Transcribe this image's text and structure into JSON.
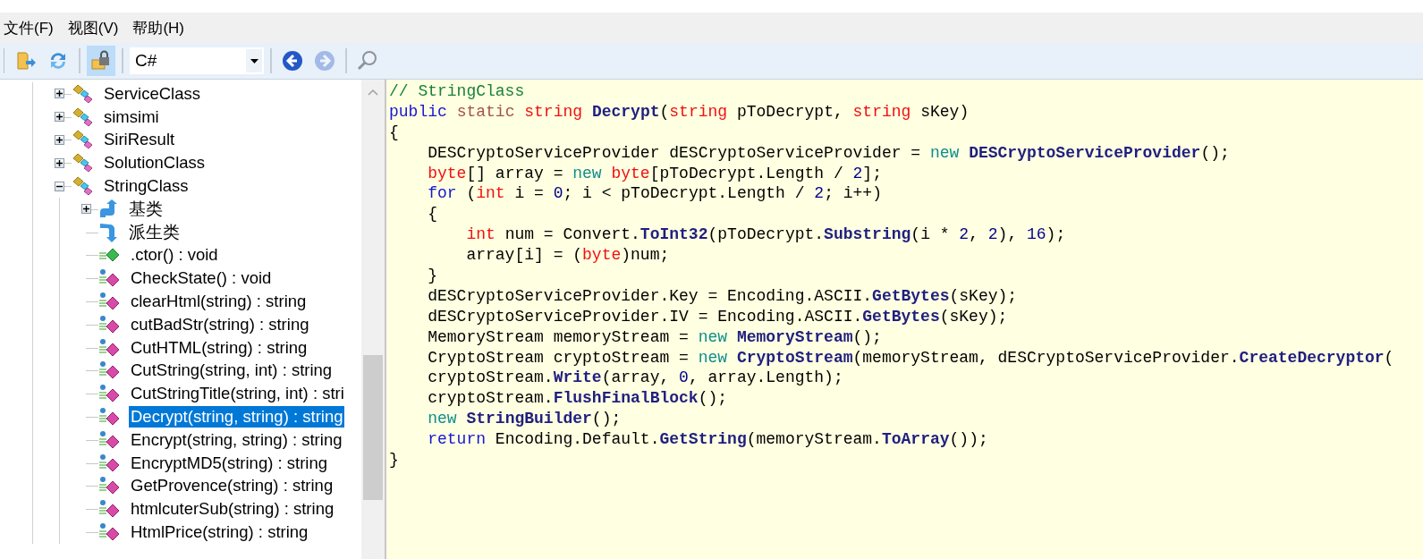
{
  "menu": [
    {
      "label": "文件(F)"
    },
    {
      "label": "视图(V)"
    },
    {
      "label": "帮助(H)"
    }
  ],
  "toolbar": {
    "file_tools": [
      {
        "kind": "open",
        "pressed": false,
        "disabled": false
      },
      {
        "kind": "refresh",
        "pressed": false,
        "disabled": false
      }
    ],
    "view_tools": [
      {
        "kind": "lock",
        "pressed": true,
        "disabled": false
      }
    ],
    "language": "C#",
    "nav_tools": [
      {
        "kind": "back",
        "pressed": false,
        "disabled": false
      },
      {
        "kind": "forward",
        "pressed": false,
        "disabled": true
      }
    ],
    "search_tools": [
      {
        "kind": "search",
        "pressed": false,
        "disabled": false
      }
    ]
  },
  "tree": {
    "items": [
      {
        "kind": "class",
        "label": "ServiceClass",
        "expanded": false,
        "selected": false
      },
      {
        "kind": "class",
        "label": "simsimi",
        "expanded": false,
        "selected": false
      },
      {
        "kind": "class",
        "label": "SiriResult",
        "expanded": false,
        "selected": false
      },
      {
        "kind": "class",
        "label": "SolutionClass",
        "expanded": false,
        "selected": false
      },
      {
        "kind": "class",
        "label": "StringClass",
        "expanded": true,
        "selected": false,
        "children": [
          {
            "kind": "base_types",
            "label": "基类",
            "expanded": false,
            "selected": false
          },
          {
            "kind": "derived_types",
            "label": "派生类",
            "selected": false
          },
          {
            "kind": "constructor",
            "label": ".ctor() : void",
            "selected": false
          },
          {
            "kind": "method",
            "label": "CheckState() : void",
            "selected": false
          },
          {
            "kind": "method",
            "label": "clearHtml(string) : string",
            "selected": false
          },
          {
            "kind": "method",
            "label": "cutBadStr(string) : string",
            "selected": false
          },
          {
            "kind": "method",
            "label": "CutHTML(string) : string",
            "selected": false
          },
          {
            "kind": "method",
            "label": "CutString(string, int) : string",
            "selected": false
          },
          {
            "kind": "method",
            "label": "CutStringTitle(string, int) : stri",
            "selected": false
          },
          {
            "kind": "method",
            "label": "Decrypt(string, string) : string",
            "selected": true
          },
          {
            "kind": "method",
            "label": "Encrypt(string, string) : string",
            "selected": false
          },
          {
            "kind": "method",
            "label": "EncryptMD5(string) : string",
            "selected": false
          },
          {
            "kind": "method",
            "label": "GetProvence(string) : string",
            "selected": false
          },
          {
            "kind": "method",
            "label": "htmlcuterSub(string) : string",
            "selected": false
          },
          {
            "kind": "method",
            "label": "HtmlPrice(string) : string",
            "selected": false
          }
        ]
      }
    ]
  },
  "code": {
    "lines": [
      {
        "tokens": [
          {
            "kind": "comment",
            "text": "// StringClass"
          }
        ]
      },
      {
        "tokens": [
          {
            "kind": "keyword",
            "text": "public "
          },
          {
            "kind": "modifier",
            "text": "static "
          },
          {
            "kind": "type",
            "text": "string "
          },
          {
            "kind": "member",
            "text": "Decrypt"
          },
          {
            "kind": "plain",
            "text": "("
          },
          {
            "kind": "type",
            "text": "string"
          },
          {
            "kind": "plain",
            "text": " pToDecrypt, "
          },
          {
            "kind": "type",
            "text": "string"
          },
          {
            "kind": "plain",
            "text": " sKey)"
          }
        ]
      },
      {
        "tokens": [
          {
            "kind": "plain",
            "text": "{"
          }
        ]
      },
      {
        "tokens": [
          {
            "kind": "plain",
            "text": "    DESCryptoServiceProvider dESCryptoServiceProvider = "
          },
          {
            "kind": "new",
            "text": "new "
          },
          {
            "kind": "member",
            "text": "DESCryptoServiceProvider"
          },
          {
            "kind": "plain",
            "text": "();"
          }
        ]
      },
      {
        "tokens": [
          {
            "kind": "type",
            "text": "    byte"
          },
          {
            "kind": "plain",
            "text": "[] array = "
          },
          {
            "kind": "new",
            "text": "new "
          },
          {
            "kind": "type",
            "text": "byte"
          },
          {
            "kind": "plain",
            "text": "[pToDecrypt.Length / "
          },
          {
            "kind": "number",
            "text": "2"
          },
          {
            "kind": "plain",
            "text": "];"
          }
        ]
      },
      {
        "tokens": [
          {
            "kind": "keyword",
            "text": "    for"
          },
          {
            "kind": "plain",
            "text": " ("
          },
          {
            "kind": "type",
            "text": "int"
          },
          {
            "kind": "plain",
            "text": " i = "
          },
          {
            "kind": "number",
            "text": "0"
          },
          {
            "kind": "plain",
            "text": "; i < pToDecrypt.Length / "
          },
          {
            "kind": "number",
            "text": "2"
          },
          {
            "kind": "plain",
            "text": "; i++)"
          }
        ]
      },
      {
        "tokens": [
          {
            "kind": "plain",
            "text": "    {"
          }
        ]
      },
      {
        "tokens": [
          {
            "kind": "type",
            "text": "        int"
          },
          {
            "kind": "plain",
            "text": " num = Convert."
          },
          {
            "kind": "member",
            "text": "ToInt32"
          },
          {
            "kind": "plain",
            "text": "(pToDecrypt."
          },
          {
            "kind": "member",
            "text": "Substring"
          },
          {
            "kind": "plain",
            "text": "(i * "
          },
          {
            "kind": "number",
            "text": "2"
          },
          {
            "kind": "plain",
            "text": ", "
          },
          {
            "kind": "number",
            "text": "2"
          },
          {
            "kind": "plain",
            "text": "), "
          },
          {
            "kind": "number",
            "text": "16"
          },
          {
            "kind": "plain",
            "text": ");"
          }
        ]
      },
      {
        "tokens": [
          {
            "kind": "plain",
            "text": "        array[i] = ("
          },
          {
            "kind": "type",
            "text": "byte"
          },
          {
            "kind": "plain",
            "text": ")num;"
          }
        ]
      },
      {
        "tokens": [
          {
            "kind": "plain",
            "text": "    }"
          }
        ]
      },
      {
        "tokens": [
          {
            "kind": "plain",
            "text": "    dESCryptoServiceProvider.Key = Encoding.ASCII."
          },
          {
            "kind": "member",
            "text": "GetBytes"
          },
          {
            "kind": "plain",
            "text": "(sKey);"
          }
        ]
      },
      {
        "tokens": [
          {
            "kind": "plain",
            "text": "    dESCryptoServiceProvider.IV = Encoding.ASCII."
          },
          {
            "kind": "member",
            "text": "GetBytes"
          },
          {
            "kind": "plain",
            "text": "(sKey);"
          }
        ]
      },
      {
        "tokens": [
          {
            "kind": "plain",
            "text": "    MemoryStream memoryStream = "
          },
          {
            "kind": "new",
            "text": "new "
          },
          {
            "kind": "member",
            "text": "MemoryStream"
          },
          {
            "kind": "plain",
            "text": "();"
          }
        ]
      },
      {
        "tokens": [
          {
            "kind": "plain",
            "text": "    CryptoStream cryptoStream = "
          },
          {
            "kind": "new",
            "text": "new "
          },
          {
            "kind": "member",
            "text": "CryptoStream"
          },
          {
            "kind": "plain",
            "text": "(memoryStream, dESCryptoServiceProvider."
          },
          {
            "kind": "member",
            "text": "CreateDecryptor"
          },
          {
            "kind": "plain",
            "text": "("
          }
        ]
      },
      {
        "tokens": [
          {
            "kind": "plain",
            "text": "    cryptoStream."
          },
          {
            "kind": "member",
            "text": "Write"
          },
          {
            "kind": "plain",
            "text": "(array, "
          },
          {
            "kind": "number",
            "text": "0"
          },
          {
            "kind": "plain",
            "text": ", array.Length);"
          }
        ]
      },
      {
        "tokens": [
          {
            "kind": "plain",
            "text": "    cryptoStream."
          },
          {
            "kind": "member",
            "text": "FlushFinalBlock"
          },
          {
            "kind": "plain",
            "text": "();"
          }
        ]
      },
      {
        "tokens": [
          {
            "kind": "new",
            "text": "    new "
          },
          {
            "kind": "member",
            "text": "StringBuilder"
          },
          {
            "kind": "plain",
            "text": "();"
          }
        ]
      },
      {
        "tokens": [
          {
            "kind": "keyword",
            "text": "    return"
          },
          {
            "kind": "plain",
            "text": " Encoding.Default."
          },
          {
            "kind": "member",
            "text": "GetString"
          },
          {
            "kind": "plain",
            "text": "(memoryStream."
          },
          {
            "kind": "member",
            "text": "ToArray"
          },
          {
            "kind": "plain",
            "text": "());"
          }
        ]
      },
      {
        "tokens": [
          {
            "kind": "plain",
            "text": "}"
          }
        ]
      }
    ]
  }
}
